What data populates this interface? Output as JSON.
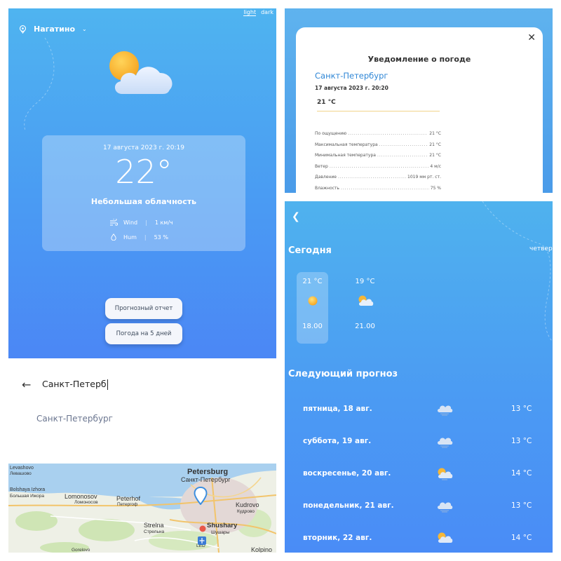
{
  "main": {
    "theme_light": "light",
    "theme_dark": "dark",
    "location": "Нагатино",
    "date": "17 августа 2023 г. 20:19",
    "temperature": "22°",
    "description": "Небольшая облачность",
    "wind_label": "Wind",
    "wind_value": "1 км/ч",
    "hum_label": "Hum",
    "hum_value": "53 %",
    "forecast_report_button": "Прогнозный отчет",
    "five_day_button": "Погода на 5 дней",
    "icons": [
      "location-pin-icon",
      "chevron-down-icon",
      "partly-cloudy-icon",
      "wind-icon",
      "droplet-icon"
    ]
  },
  "notification": {
    "title": "Уведомление о погоде",
    "city": "Санкт-Петербург",
    "date": "17 августа 2023 г. 20:20",
    "temperature": "21 °C",
    "stats": [
      {
        "label": "По ощущению",
        "value": "21 °C"
      },
      {
        "label": "Максимальная температура",
        "value": "21 °C"
      },
      {
        "label": "Минимальная температура",
        "value": "21 °C"
      },
      {
        "label": "Ветер",
        "value": "4 м/с"
      },
      {
        "label": "Давление",
        "value": "1019 мм рт. ст."
      },
      {
        "label": "Влажность",
        "value": "75 %"
      }
    ]
  },
  "search": {
    "query": "Санкт-Петерб",
    "result": "Санкт-Петербург",
    "map_labels": {
      "levashovo": "Levashovo",
      "levashovo_ru": "Левашово",
      "bolshaya": "Bolshaya Izhora",
      "bolshaya_ru": "Большая Ижора",
      "lomonosov": "Lomonosov",
      "lomonosov_ru": "Ломоносов",
      "peterhof": "Peterhof",
      "peterhof_ru": "Петергоф",
      "petersburg": "Petersburg",
      "petersburg_ru": "Санкт-Петербург",
      "kudrovo": "Kudrovo",
      "kudrovo_ru": "Кудрово",
      "strelna": "Strelna",
      "strelna_ru": "Стрельна",
      "shushary": "Shushary",
      "shushary_ru": "Шушары",
      "led": "LED",
      "kolpino": "Kolpino",
      "gorelovo": "Gorelovo"
    }
  },
  "forecast": {
    "today_heading": "Сегодня",
    "next_day_cut": "четвер",
    "hours": [
      {
        "temp": "21 °C",
        "time": "18.00",
        "icon": "sun-icon"
      },
      {
        "temp": "19 °C",
        "time": "21.00",
        "icon": "partly-cloudy-icon"
      }
    ],
    "next_heading": "Следующий прогноз",
    "days": [
      {
        "name": "пятница, 18 авг.",
        "temp": "13 °C",
        "icon": "cloud-icon"
      },
      {
        "name": "суббота, 19 авг.",
        "temp": "13 °C",
        "icon": "cloud-icon"
      },
      {
        "name": "воскресенье, 20 авг.",
        "temp": "14 °C",
        "icon": "partly-cloudy-icon"
      },
      {
        "name": "понедельник, 21 авг.",
        "temp": "13 °C",
        "icon": "cloud-icon"
      },
      {
        "name": "вторник, 22 авг.",
        "temp": "14 °C",
        "icon": "partly-cloudy-icon"
      }
    ]
  },
  "colors": {
    "sky_top": "#4fb4f0",
    "sky_bottom": "#4b87f5",
    "link_blue": "#2e86d6",
    "sun": "#f8b935"
  }
}
